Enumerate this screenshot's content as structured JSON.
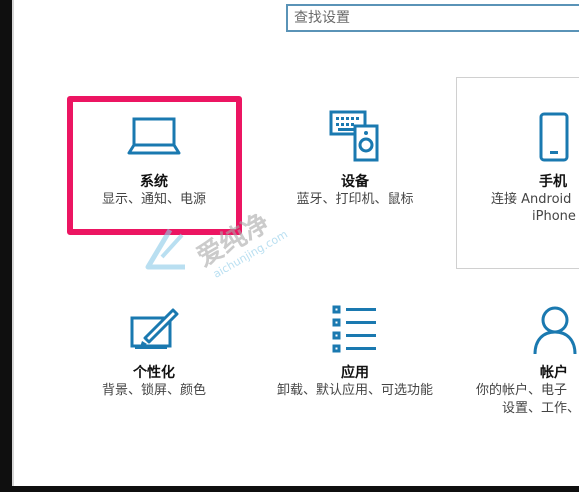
{
  "search": {
    "placeholder": "查找设置"
  },
  "tiles": [
    {
      "title": "系统",
      "desc": "显示、通知、电源",
      "icon": "laptop-icon"
    },
    {
      "title": "设备",
      "desc": "蓝牙、打印机、鼠标",
      "icon": "keyboard-speaker-icon"
    },
    {
      "title": "手机",
      "desc": "连接 Android 设备和 iPhone",
      "desc_line1": "连接 Android",
      "desc_line2": "iPhone",
      "icon": "phone-icon"
    },
    {
      "title": "个性化",
      "desc": "背景、锁屏、颜色",
      "icon": "paint-brush-icon"
    },
    {
      "title": "应用",
      "desc": "卸载、默认应用、可选功能",
      "icon": "apps-list-icon"
    },
    {
      "title": "帐户",
      "desc": "你的帐户、电子邮件、同步设置、工作、家庭",
      "desc_line1": "你的帐户、电子",
      "desc_line2": "设置、工作、",
      "icon": "person-icon"
    }
  ],
  "watermark": {
    "text": "爱纯净",
    "subtext": "aichunjing.com"
  },
  "colors": {
    "accent": "#1a79b0",
    "highlight": "#ec1562"
  }
}
